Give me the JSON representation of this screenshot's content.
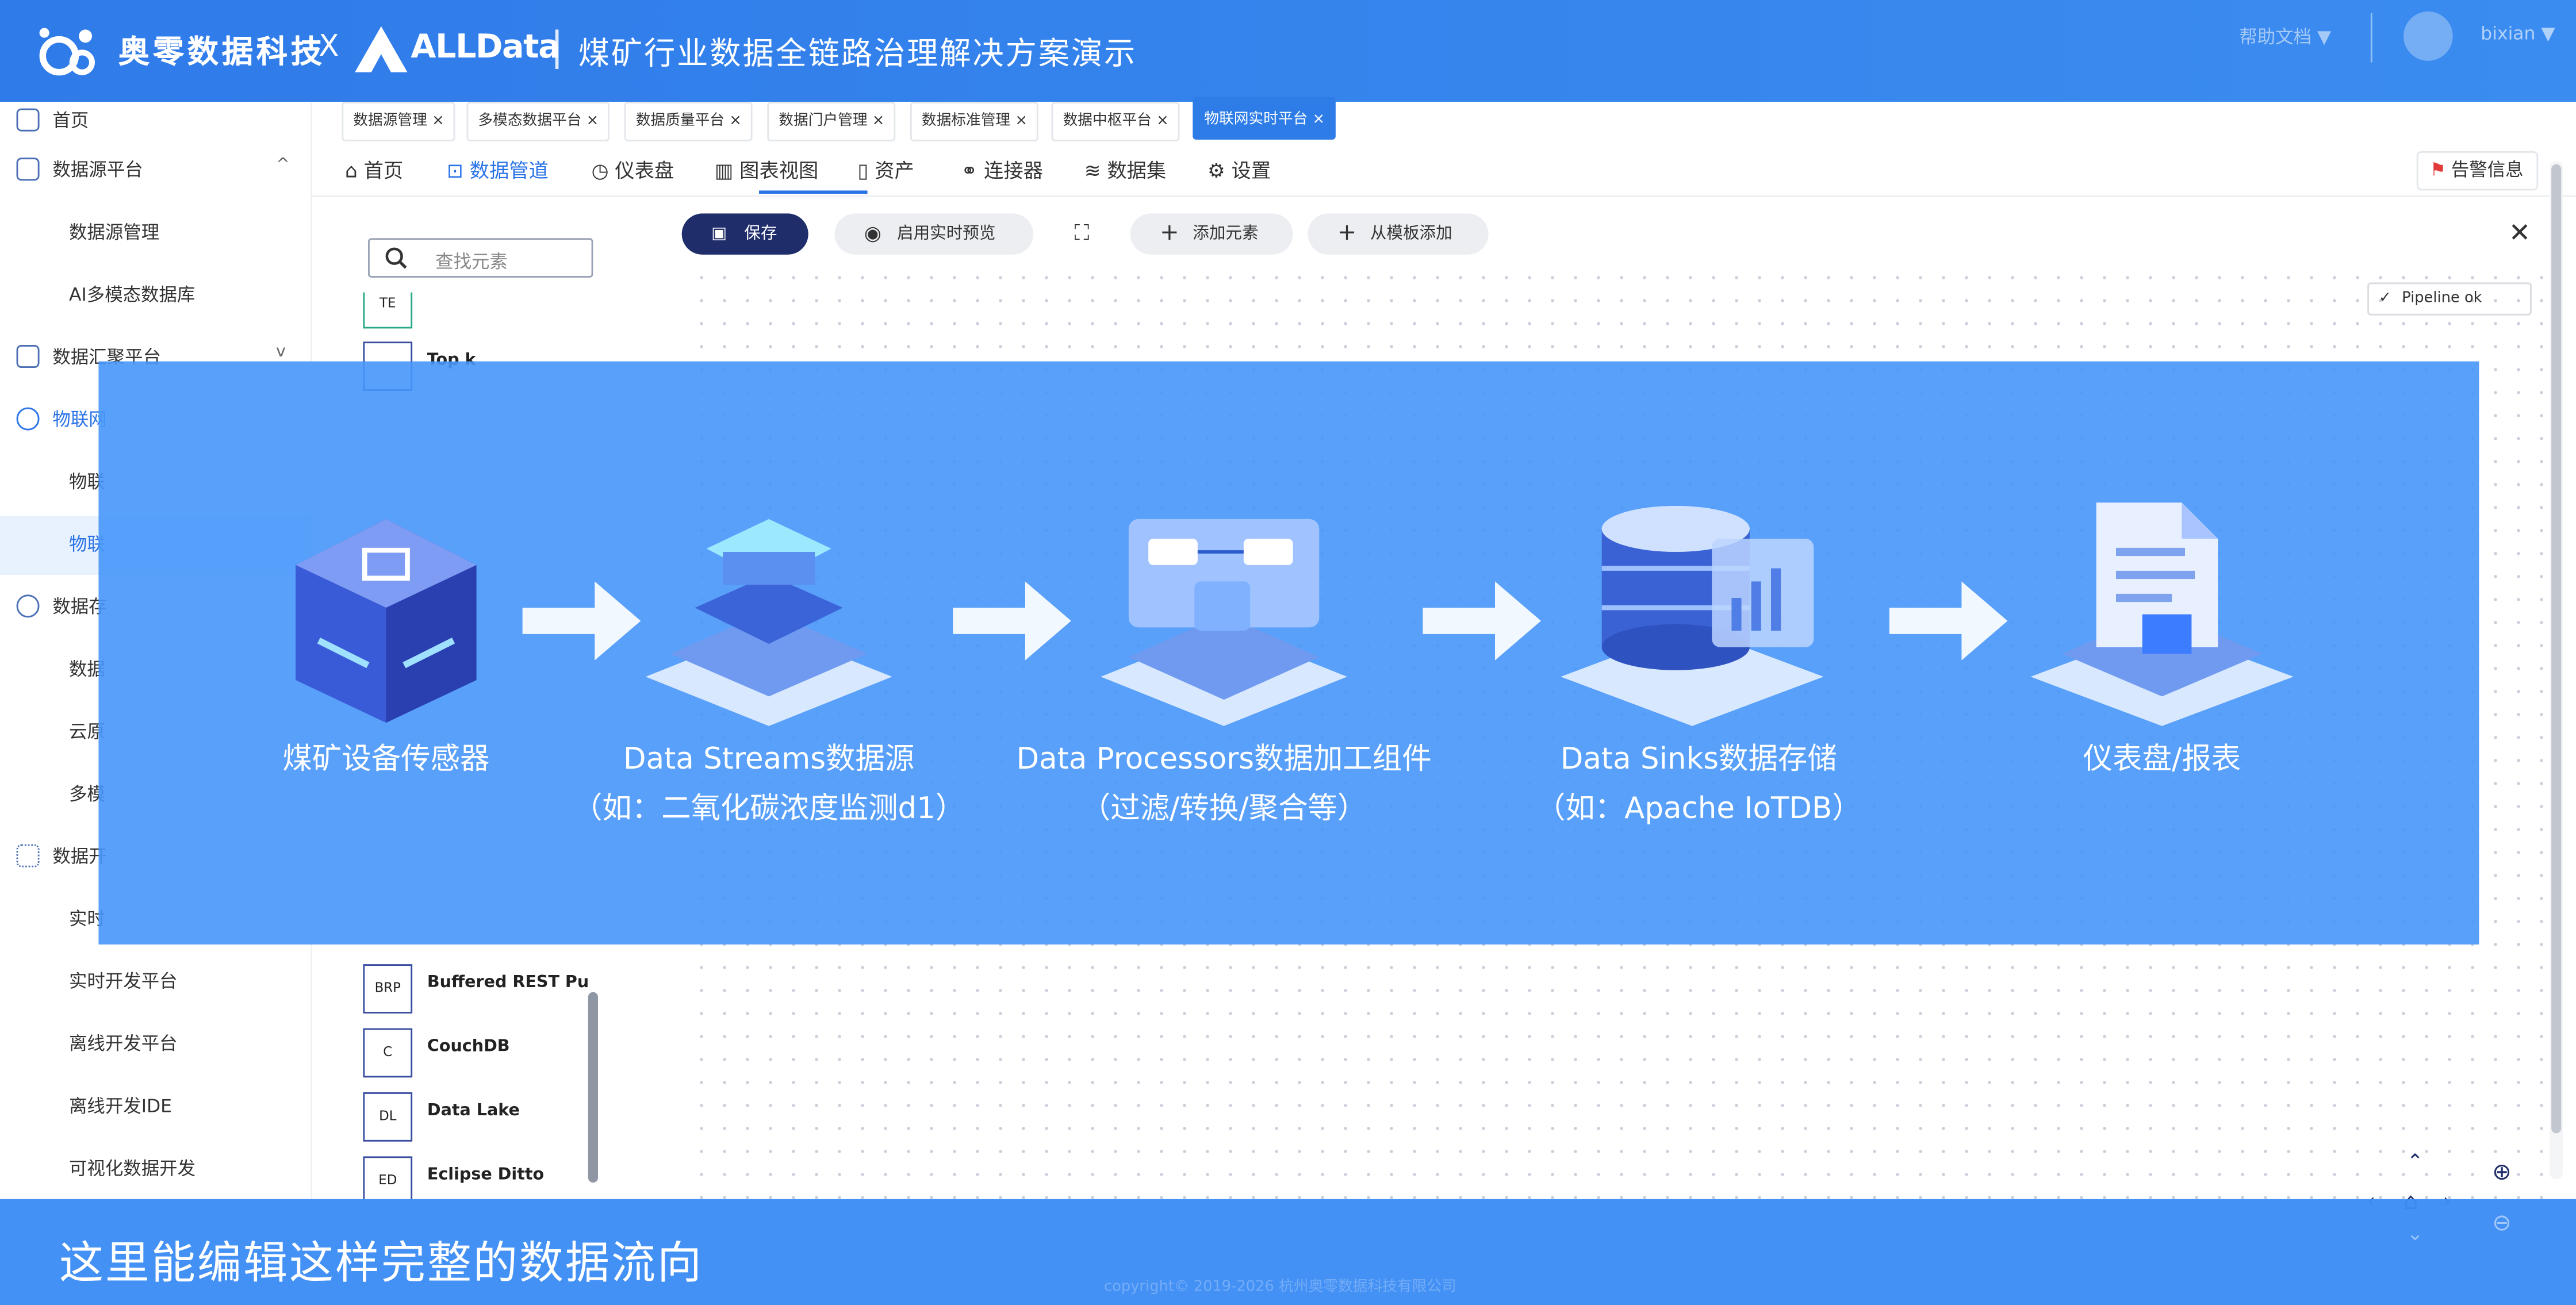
{
  "brand": {
    "company": "奥零数据科技",
    "x": "X",
    "product": "ALLData",
    "title": "煤矿行业数据全链路治理解决方案演示",
    "help": "帮助文档 ▼",
    "user": "bixian ▼"
  },
  "sidebar": {
    "items": [
      {
        "label": "首页"
      },
      {
        "label": "数据源平台",
        "arrow": "^"
      },
      {
        "label": "数据源管理"
      },
      {
        "label": "AI多模态数据库"
      },
      {
        "label": "数据汇聚平台",
        "arrow": "v"
      },
      {
        "label": "物联网"
      },
      {
        "label": "物联"
      },
      {
        "label": "物联"
      },
      {
        "label": "数据存"
      },
      {
        "label": "数据"
      },
      {
        "label": "云原"
      },
      {
        "label": "多模"
      },
      {
        "label": "数据开"
      },
      {
        "label": "实时"
      },
      {
        "label": "实时开发平台"
      },
      {
        "label": "离线开发平台"
      },
      {
        "label": "离线开发IDE"
      },
      {
        "label": "可视化数据开发"
      }
    ]
  },
  "tabs": [
    {
      "label": "数据源管理"
    },
    {
      "label": "多模态数据平台"
    },
    {
      "label": "数据质量平台"
    },
    {
      "label": "数据门户管理"
    },
    {
      "label": "数据标准管理"
    },
    {
      "label": "数据中枢平台"
    },
    {
      "label": "物联网实时平台"
    }
  ],
  "nav": {
    "items": [
      {
        "label": "首页"
      },
      {
        "label": "数据管道"
      },
      {
        "label": "仪表盘"
      },
      {
        "label": "图表视图"
      },
      {
        "label": "资产"
      },
      {
        "label": "连接器"
      },
      {
        "label": "数据集"
      },
      {
        "label": "设置"
      }
    ],
    "alert": "告警信息"
  },
  "editor": {
    "search_placeholder": "查找元素",
    "save": "保存",
    "preview": "启用实时预览",
    "add_element": "添加元素",
    "from_template": "从模板添加",
    "pipeline_status": "Pipeline ok",
    "elements_top": [
      {
        "abbr": "TE",
        "name": ""
      },
      {
        "abbr": "",
        "name": "Top k"
      }
    ],
    "elements_bottom": [
      {
        "abbr": "BRP",
        "name": "Buffered REST Publis"
      },
      {
        "abbr": "C",
        "name": "CouchDB"
      },
      {
        "abbr": "DL",
        "name": "Data Lake"
      },
      {
        "abbr": "ED",
        "name": "Eclipse Ditto"
      }
    ]
  },
  "overlay": {
    "stages": [
      {
        "line1": "煤矿设备传感器",
        "line2": ""
      },
      {
        "line1": "Data Streams数据源",
        "line2": "（如：二氧化碳浓度监测d1）"
      },
      {
        "line1": "Data Processors数据加工组件",
        "line2": "（过滤/转换/聚合等）"
      },
      {
        "line1": "Data Sinks数据存储",
        "line2": "（如：Apache IoTDB）"
      },
      {
        "line1": "仪表盘/报表",
        "line2": ""
      }
    ]
  },
  "caption": "这里能编辑这样完整的数据流向",
  "copyright": "copyright© 2019-2026 杭州奥零数据科技有限公司"
}
